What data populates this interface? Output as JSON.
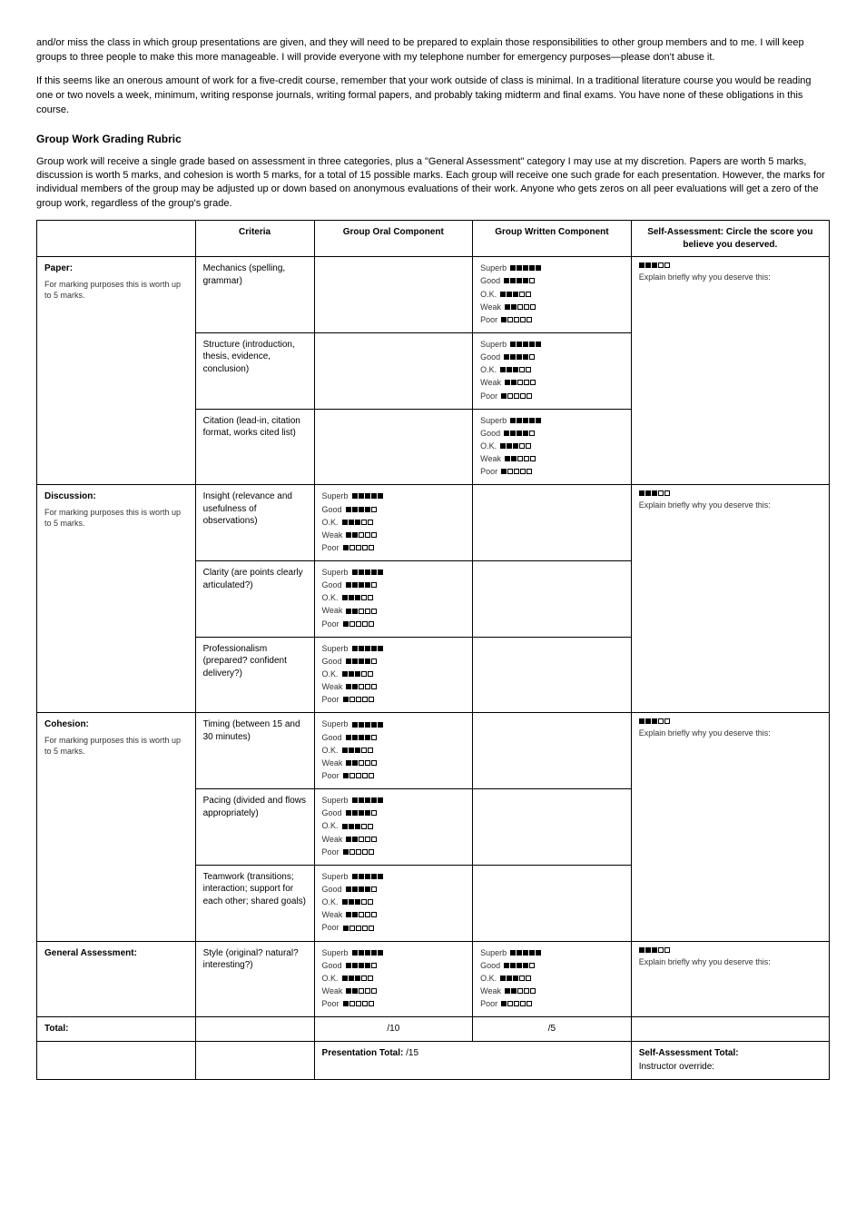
{
  "top": {
    "p1": "and/or miss the class in which group presentations are given, and they will need to be prepared to explain those responsibilities to other group members and to me. I will keep groups to three people to make this more manageable. I will provide everyone with my telephone number for emergency purposes—please don't abuse it.",
    "p2": "If this seems like an onerous amount of work for a five-credit course, remember that your work outside of class is minimal. In a traditional literature course you would be reading one or two novels a week, minimum, writing response journals, writing formal papers, and probably taking midterm and final exams. You have none of these obligations in this course."
  },
  "section_title": "Group Work Grading Rubric",
  "intro": "Group work will receive a single grade based on assessment in three categories, plus a \"General Assessment\" category I may use at my discretion. Papers are worth 5 marks, discussion is worth 5 marks, and cohesion is worth 5 marks, for a total of 15 possible marks. Each group will receive one such grade for each presentation. However, the marks for individual members of the group may be adjusted up or down based on anonymous evaluations of their work. Anyone who gets zeros on all peer evaluations will get a zero of the group work, regardless of the group's grade.",
  "headers": {
    "col1": "",
    "col2": "Criteria",
    "col3": "Group Oral Component",
    "col4": "Group Written Component",
    "col5": "Self-Assessment: Circle the score you believe you deserved."
  },
  "rows": [
    {
      "category": "Paper:",
      "desc": "For marking purposes this is worth up to 5 marks.",
      "crit_title": "",
      "crit_items": [
        "Mechanics (spelling, grammar)",
        "Structure (introduction, thesis, evidence, conclusion)",
        "Citation (lead-in, citation format, works cited list)"
      ],
      "oral": null,
      "written_scale": true,
      "self": 3,
      "explain": "Explain briefly why you deserve this:"
    },
    {
      "category": "Discussion:",
      "desc": "For marking purposes this is worth up to 5 marks.",
      "crit_title": "",
      "crit_items": [
        "Insight (relevance and usefulness of observations)",
        "Clarity (are points clearly articulated?)",
        "Professionalism (prepared? confident delivery?)"
      ],
      "oral_scale": true,
      "written": null,
      "self": 3,
      "explain": "Explain briefly why you deserve this:"
    },
    {
      "category": "Cohesion:",
      "desc": "For marking purposes this is worth up to 5 marks.",
      "crit_title": "",
      "crit_items": [
        "Timing (between 15 and 30 minutes)",
        "Pacing (divided and flows appropriately)",
        "Teamwork (transitions; interaction; support for each other; shared goals)"
      ],
      "oral_scale": true,
      "written": null,
      "self": 3,
      "explain": "Explain briefly why you deserve this:"
    }
  ],
  "ga": {
    "category": "General Assessment:",
    "desc": "",
    "crit": "Style (original? natural? interesting?)",
    "oral_scale": true,
    "written_scale": true,
    "self": 3,
    "explain": "Explain briefly why you deserve this:"
  },
  "total_row": {
    "label": "Total:",
    "oral": "/10",
    "written": "/5",
    "self": ""
  },
  "footer_row": {
    "col1": "",
    "col2": "",
    "col3_label": "Presentation Total:",
    "col3_val": "/15",
    "col4_label": "Self-Assessment Total:",
    "col4_val": "Instructor override:"
  },
  "scale_labels": [
    "Superb",
    "Good",
    "O.K.",
    "Weak",
    "Poor"
  ]
}
